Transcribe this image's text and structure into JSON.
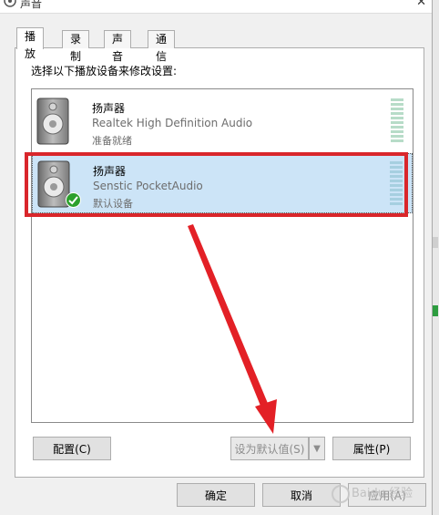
{
  "window": {
    "title": "声音",
    "close_glyph": "✕"
  },
  "tabs": [
    {
      "label": "播放",
      "active": true
    },
    {
      "label": "录制",
      "active": false
    },
    {
      "label": "声音",
      "active": false
    },
    {
      "label": "通信",
      "active": false
    }
  ],
  "instruction": "选择以下播放设备来修改设置:",
  "devices": [
    {
      "name": "扬声器",
      "driver": "Realtek High Definition Audio",
      "status": "准备就绪",
      "selected": false,
      "icon": "speaker-icon"
    },
    {
      "name": "扬声器",
      "driver": "Senstic PocketAudio",
      "status": "默认设备",
      "selected": true,
      "icon": "speaker-icon",
      "badge": "default-check-icon"
    }
  ],
  "buttons": {
    "configure": "配置(C)",
    "set_default": "设为默认值(S)",
    "set_default_arrow": "▼",
    "properties": "属性(P)",
    "ok": "确定",
    "cancel": "取消",
    "apply": "应用(A)"
  },
  "watermark": "Baidu 经验",
  "colors": {
    "selection": "#cce4f7",
    "annotation_red": "#d9262b",
    "default_check": "#2ca02c"
  }
}
